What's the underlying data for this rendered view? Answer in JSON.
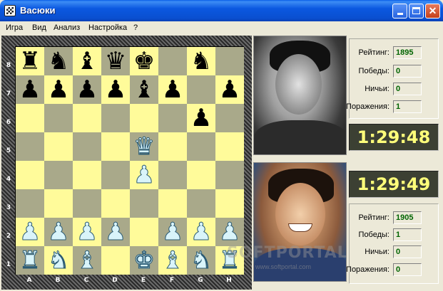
{
  "window": {
    "title": "Васюки",
    "icon": "chessboard-icon"
  },
  "menu": [
    {
      "label": "Игра"
    },
    {
      "label": "Вид"
    },
    {
      "label": "Анализ"
    },
    {
      "label": "Настройка"
    },
    {
      "label": "?"
    }
  ],
  "board": {
    "ranks": [
      "8",
      "7",
      "6",
      "5",
      "4",
      "3",
      "2",
      "1"
    ],
    "files": [
      "A",
      "B",
      "C",
      "D",
      "E",
      "F",
      "G",
      "H"
    ],
    "rows": [
      [
        "bR",
        "bN",
        "bB",
        "bQ",
        "bK",
        "",
        "bN",
        ""
      ],
      [
        "bP",
        "bP",
        "bP",
        "bP",
        "bB",
        "bP",
        "",
        "bP"
      ],
      [
        "",
        "",
        "",
        "",
        "",
        "",
        "bP",
        ""
      ],
      [
        "",
        "",
        "",
        "",
        "wQ",
        "",
        "",
        ""
      ],
      [
        "",
        "",
        "",
        "",
        "wP",
        "",
        "",
        ""
      ],
      [
        "",
        "",
        "",
        "",
        "",
        "",
        "",
        ""
      ],
      [
        "wP",
        "wP",
        "wP",
        "wP",
        "",
        "wP",
        "wP",
        "wP"
      ],
      [
        "wR",
        "wN",
        "wB",
        "",
        "wK",
        "wB",
        "wN",
        "wR"
      ]
    ]
  },
  "pieces_glyphs": {
    "K": "♚",
    "Q": "♛",
    "R": "♜",
    "B": "♝",
    "N": "♞",
    "P": "♟"
  },
  "opponent": {
    "stats": [
      {
        "label": "Рейтинг:",
        "value": "1895"
      },
      {
        "label": "Победы:",
        "value": "0"
      },
      {
        "label": "Ничьи:",
        "value": "0"
      },
      {
        "label": "Поражения:",
        "value": "1"
      }
    ],
    "clock": "1:29:48"
  },
  "player": {
    "clock": "1:29:49",
    "stats": [
      {
        "label": "Рейтинг:",
        "value": "1905"
      },
      {
        "label": "Победы:",
        "value": "1"
      },
      {
        "label": "Ничьи:",
        "value": "0"
      },
      {
        "label": "Поражения:",
        "value": "0"
      }
    ]
  },
  "watermark": {
    "main": "SOFTPORTAL",
    "sub": "www.softportal.com"
  },
  "colors": {
    "light_square": "#fffb9a",
    "dark_square": "#a9a98a",
    "clock_text": "#ffff7a",
    "stat_value": "#006400"
  }
}
